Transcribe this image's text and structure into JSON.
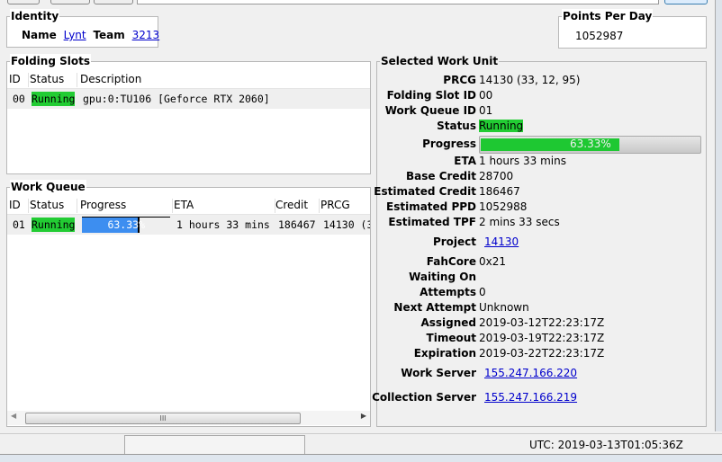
{
  "identity": {
    "title": "Identity",
    "name_label": "Name",
    "name": "Lynt",
    "team_label": "Team",
    "team": "3213"
  },
  "ppd": {
    "title": "Points Per Day",
    "value": "1052987"
  },
  "slots": {
    "title": "Folding Slots",
    "columns": [
      "ID",
      "Status",
      "Description"
    ],
    "rows": [
      {
        "id": "00",
        "status": "Running",
        "description": "gpu:0:TU106 [Geforce RTX 2060]"
      }
    ]
  },
  "queue": {
    "title": "Work Queue",
    "columns": [
      "ID",
      "Status",
      "Progress",
      "ETA",
      "Credit",
      "PRCG"
    ],
    "rows": [
      {
        "id": "01",
        "status": "Running",
        "progress": "63.33%",
        "progress_value": 63.33,
        "eta": "1 hours 33 mins",
        "credit": "186467",
        "prcg": "14130 (3"
      }
    ],
    "scroll_thumb": "III"
  },
  "wu": {
    "title": "Selected Work Unit",
    "fields": [
      {
        "label": "PRCG",
        "value": "14130 (33, 12, 95)"
      },
      {
        "label": "Folding Slot ID",
        "value": "00"
      },
      {
        "label": "Work Queue ID",
        "value": "01"
      },
      {
        "label": "Status",
        "value": "Running"
      },
      {
        "label": "Progress",
        "value": "63.33%"
      },
      {
        "label": "ETA",
        "value": "1 hours 33 mins"
      },
      {
        "label": "Base Credit",
        "value": "28700"
      },
      {
        "label": "Estimated Credit",
        "value": "186467"
      },
      {
        "label": "Estimated PPD",
        "value": "1052988"
      },
      {
        "label": "Estimated TPF",
        "value": "2 mins 33 secs"
      },
      {
        "label": "Project",
        "value": "14130"
      },
      {
        "label": "FahCore",
        "value": "0x21"
      },
      {
        "label": "Waiting On",
        "value": ""
      },
      {
        "label": "Attempts",
        "value": "0"
      },
      {
        "label": "Next Attempt",
        "value": "Unknown"
      },
      {
        "label": "Assigned",
        "value": "2019-03-12T22:23:17Z"
      },
      {
        "label": "Timeout",
        "value": "2019-03-19T22:23:17Z"
      },
      {
        "label": "Expiration",
        "value": "2019-03-22T22:23:17Z"
      },
      {
        "label": "Work Server",
        "value": "155.247.166.220"
      },
      {
        "label": "Collection Server",
        "value": "155.247.166.219"
      }
    ],
    "progress_value": 63.33
  },
  "status_bar": {
    "utc": "UTC: 2019-03-13T01:05:36Z"
  },
  "colors": {
    "running": "#22cc33",
    "progress_green": "#1ec832",
    "queue_progress": "#3d8ef0",
    "link": "#0000cc"
  }
}
